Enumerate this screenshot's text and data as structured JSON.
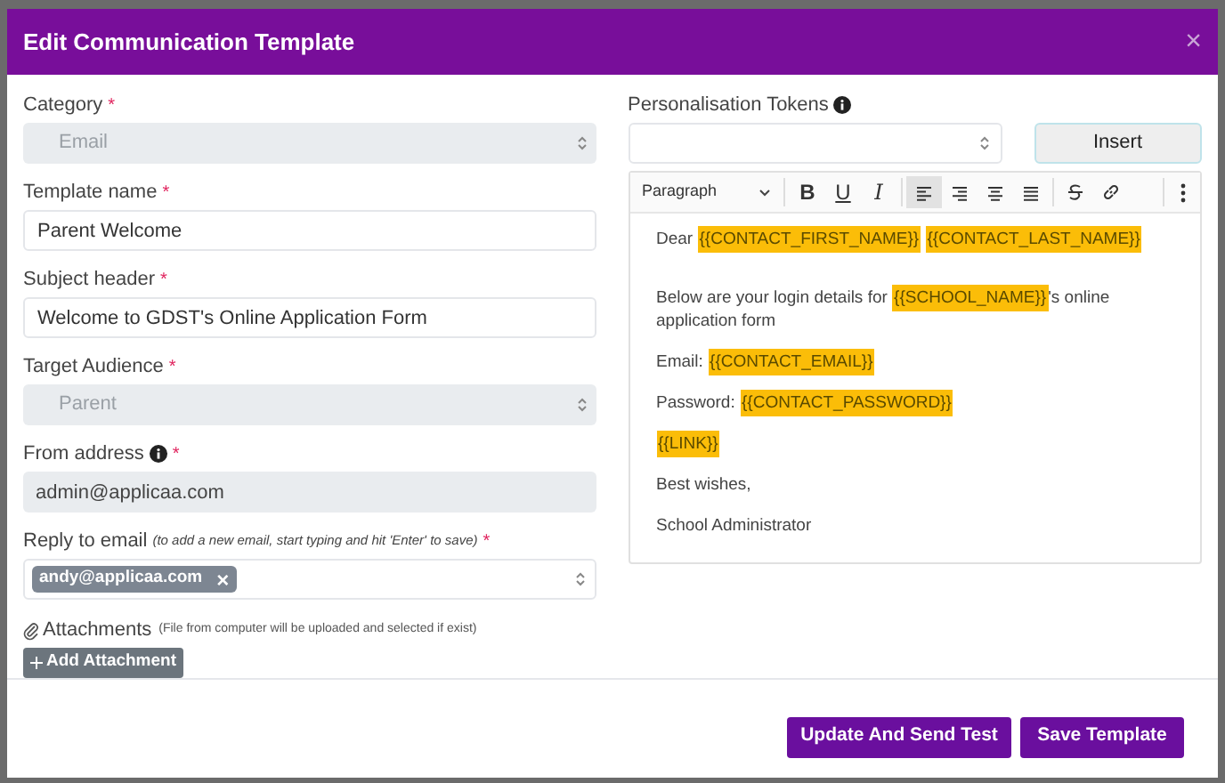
{
  "dialog": {
    "title": "Edit Communication Template",
    "close": "×"
  },
  "fields": [
    {
      "kind": "select",
      "label": "Category",
      "required": "*",
      "disabled": true,
      "value": "Email"
    },
    {
      "kind": "input",
      "label": "Template name",
      "required": "*",
      "disabled": false,
      "value": "Parent Welcome"
    },
    {
      "kind": "input",
      "label": "Subject header",
      "required": "*",
      "disabled": false,
      "value": "Welcome to GDST's Online Application Form"
    },
    {
      "kind": "select",
      "label": "Target Audience",
      "required": "*",
      "disabled": true,
      "value": "Parent"
    },
    {
      "kind": "input",
      "label": "From address",
      "info": true,
      "required": "*",
      "disabled": true,
      "value": "admin@applicaa.com"
    },
    {
      "kind": "tags",
      "label": "Reply to email",
      "hint": "(to add a new email, start typing and hit 'Enter' to save)",
      "required": "*",
      "disabled": false,
      "tags": [
        {
          "text": "andy@applicaa.com",
          "remove": "×"
        }
      ]
    }
  ],
  "attachments": {
    "label": "Attachments",
    "hint": "(File from computer will be uploaded and selected if exist)",
    "button": "Add Attachment"
  },
  "tokens": {
    "label": "Personalisation Tokens",
    "info": true,
    "button": "Insert"
  },
  "editor": {
    "block_format": "Paragraph",
    "format_buttons": [
      "B",
      "U",
      "I"
    ],
    "align_buttons": [
      {
        "selected": true
      },
      {
        "selected": false
      },
      {
        "selected": false
      },
      {
        "selected": false
      }
    ],
    "paragraphs": [
      {
        "segments": [
          {
            "kind": "text",
            "text": "Dear"
          },
          {
            "kind": "token",
            "text": "{{CONTACT_FIRST_NAME}}"
          },
          {
            "kind": "token",
            "text": "{{CONTACT_LAST_NAME}}"
          }
        ]
      },
      {
        "segments": [
          {
            "kind": "text",
            "text": "Below are your login details for"
          },
          {
            "kind": "token",
            "text": "{{SCHOOL_NAME}}"
          },
          {
            "kind": "suffix",
            "text": "'s online application form"
          }
        ]
      },
      {
        "segments": [
          {
            "kind": "text",
            "text": "Email:"
          },
          {
            "kind": "token",
            "text": "{{CONTACT_EMAIL}}"
          }
        ]
      },
      {
        "segments": [
          {
            "kind": "text",
            "text": "Password:"
          },
          {
            "kind": "token",
            "text": "{{CONTACT_PASSWORD}}"
          }
        ]
      },
      {
        "segments": [
          {
            "kind": "token",
            "text": "{{LINK}}"
          }
        ]
      },
      {
        "segments": [
          {
            "kind": "text",
            "text": "Best wishes,"
          }
        ]
      },
      {
        "segments": [
          {
            "kind": "text",
            "text": "School Administrator"
          }
        ]
      }
    ]
  },
  "footer_buttons": [
    "Update And Send Test",
    "Save Template"
  ]
}
